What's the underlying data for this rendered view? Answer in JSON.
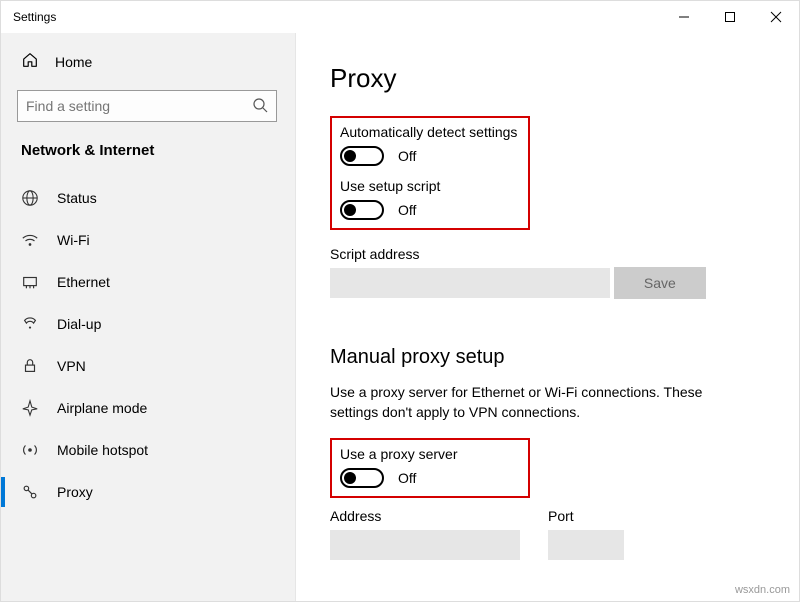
{
  "window": {
    "title": "Settings"
  },
  "sidebar": {
    "home_label": "Home",
    "search_placeholder": "Find a setting",
    "section_title": "Network & Internet",
    "items": [
      {
        "label": "Status"
      },
      {
        "label": "Wi-Fi"
      },
      {
        "label": "Ethernet"
      },
      {
        "label": "Dial-up"
      },
      {
        "label": "VPN"
      },
      {
        "label": "Airplane mode"
      },
      {
        "label": "Mobile hotspot"
      },
      {
        "label": "Proxy"
      }
    ]
  },
  "main": {
    "page_title": "Proxy",
    "auto": {
      "detect_label": "Automatically detect settings",
      "detect_state": "Off",
      "script_label": "Use setup script",
      "script_state": "Off",
      "script_address_label": "Script address",
      "save_label": "Save"
    },
    "manual": {
      "heading": "Manual proxy setup",
      "description": "Use a proxy server for Ethernet or Wi-Fi connections. These settings don't apply to VPN connections.",
      "use_proxy_label": "Use a proxy server",
      "use_proxy_state": "Off",
      "address_label": "Address",
      "port_label": "Port"
    }
  },
  "watermark": "wsxdn.com"
}
